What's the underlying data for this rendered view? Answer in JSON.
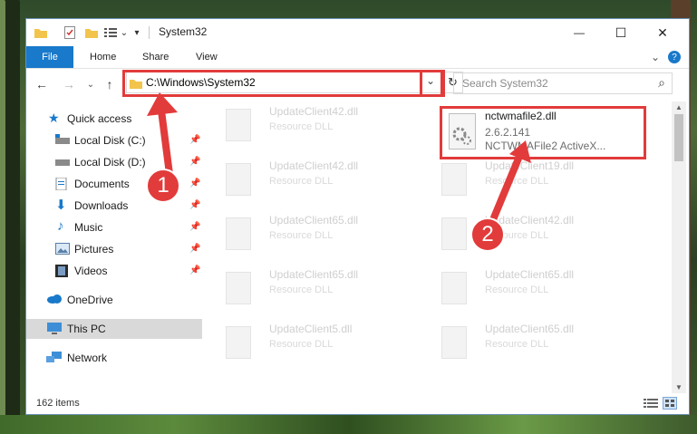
{
  "window": {
    "title": "System32",
    "minimize_glyph": "—",
    "maximize_glyph": "☐",
    "close_glyph": "✕",
    "help_glyph": "?",
    "collapse_glyph": "⌄"
  },
  "ribbon": {
    "tabs": [
      "File",
      "Home",
      "Share",
      "View"
    ]
  },
  "address_bar": {
    "path": "C:\\Windows\\System32",
    "dropdown_glyph": "⌄",
    "refresh_glyph": "↻"
  },
  "search": {
    "placeholder": "Search System32",
    "icon_glyph": "⌕"
  },
  "nav": {
    "back_glyph": "←",
    "forward_glyph": "→",
    "recent_glyph": "⌄",
    "up_glyph": "↑"
  },
  "sidebar": {
    "items": [
      {
        "label": "Quick access",
        "icon": "star-icon"
      },
      {
        "label": "Local Disk (C:)",
        "icon": "drive-icon"
      },
      {
        "label": "Local Disk (D:)",
        "icon": "drive-icon"
      },
      {
        "label": "Documents",
        "icon": "documents-icon"
      },
      {
        "label": "Downloads",
        "icon": "downloads-icon"
      },
      {
        "label": "Music",
        "icon": "music-icon"
      },
      {
        "label": "Pictures",
        "icon": "pictures-icon"
      },
      {
        "label": "Videos",
        "icon": "videos-icon"
      },
      {
        "label": "OneDrive",
        "icon": "cloud-icon"
      },
      {
        "label": "This PC",
        "icon": "computer-icon"
      },
      {
        "label": "Network",
        "icon": "network-icon"
      }
    ]
  },
  "files": {
    "left": [
      {
        "name": "UpdateClient42.dll",
        "desc": "Resource DLL"
      },
      {
        "name": "UpdateClient42.dll",
        "desc": "Resource DLL"
      },
      {
        "name": "UpdateClient65.dll",
        "desc": "Resource DLL"
      },
      {
        "name": "UpdateClient65.dll",
        "desc": "Resource DLL"
      },
      {
        "name": "UpdateClient5.dll",
        "desc": "Resource DLL"
      }
    ],
    "right": [
      {
        "name": "UpdateClient19.dll",
        "desc": "Resource DLL"
      },
      {
        "name": "UpdateClient42.dll",
        "desc": "Resource DLL"
      },
      {
        "name": "UpdateClient65.dll",
        "desc": "Resource DLL"
      },
      {
        "name": "UpdateClient65.dll",
        "desc": "Resource DLL"
      }
    ],
    "highlighted": {
      "name": "nctwmafile2.dll",
      "version": "2.6.2.141",
      "description": "NCTWMAFile2 ActiveX..."
    }
  },
  "status": {
    "item_count": "162 items"
  },
  "annotations": {
    "step1": "1",
    "step2": "2",
    "color": "#e23b3b"
  }
}
